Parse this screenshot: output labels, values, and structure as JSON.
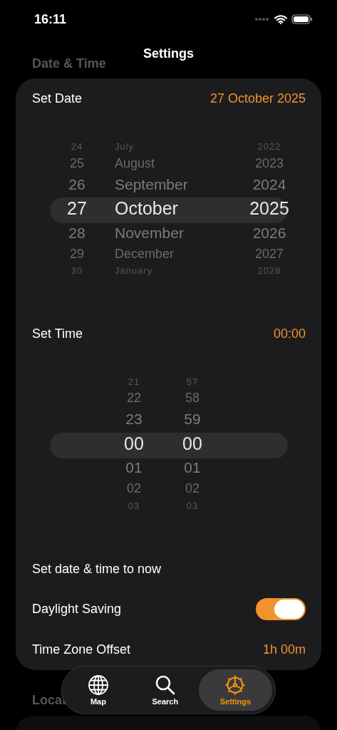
{
  "status_bar": {
    "time": "16:11"
  },
  "nav": {
    "title": "Settings"
  },
  "section_header": "Date & Time",
  "date_row": {
    "label": "Set Date",
    "value": "27 October 2025"
  },
  "date_picker": {
    "columns": [
      {
        "kind": "day",
        "items": [
          {
            "label": "24",
            "selected": false
          },
          {
            "label": "25",
            "selected": false
          },
          {
            "label": "26",
            "selected": false
          },
          {
            "label": "27",
            "selected": true
          },
          {
            "label": "28",
            "selected": false
          },
          {
            "label": "29",
            "selected": false
          },
          {
            "label": "30",
            "selected": false
          }
        ]
      },
      {
        "kind": "month",
        "items": [
          {
            "label": "July",
            "selected": false
          },
          {
            "label": "August",
            "selected": false
          },
          {
            "label": "September",
            "selected": false
          },
          {
            "label": "October",
            "selected": true
          },
          {
            "label": "November",
            "selected": false
          },
          {
            "label": "December",
            "selected": false
          },
          {
            "label": "January",
            "selected": false
          }
        ]
      },
      {
        "kind": "year",
        "items": [
          {
            "label": "2022",
            "selected": false
          },
          {
            "label": "2023",
            "selected": false
          },
          {
            "label": "2024",
            "selected": false
          },
          {
            "label": "2025",
            "selected": true
          },
          {
            "label": "2026",
            "selected": false
          },
          {
            "label": "2027",
            "selected": false
          },
          {
            "label": "2028",
            "selected": false
          }
        ]
      }
    ]
  },
  "time_row": {
    "label": "Set Time",
    "value": "00:00"
  },
  "time_picker": {
    "columns": [
      {
        "kind": "hour",
        "items": [
          {
            "label": "21",
            "selected": false
          },
          {
            "label": "22",
            "selected": false
          },
          {
            "label": "23",
            "selected": false
          },
          {
            "label": "00",
            "selected": true
          },
          {
            "label": "01",
            "selected": false
          },
          {
            "label": "02",
            "selected": false
          },
          {
            "label": "03",
            "selected": false
          }
        ]
      },
      {
        "kind": "minute",
        "items": [
          {
            "label": "57",
            "selected": false
          },
          {
            "label": "58",
            "selected": false
          },
          {
            "label": "59",
            "selected": false
          },
          {
            "label": "00",
            "selected": true
          },
          {
            "label": "01",
            "selected": false
          },
          {
            "label": "02",
            "selected": false
          },
          {
            "label": "03",
            "selected": false
          }
        ]
      }
    ]
  },
  "now_button": "Set date & time to now",
  "daylight_saving": {
    "label": "Daylight Saving",
    "on": true
  },
  "timezone_row": {
    "label": "Time Zone Offset",
    "value": "1h 00m"
  },
  "next_section_header": "Locat",
  "tab_bar": [
    {
      "kind": "map",
      "label": "Map",
      "selected": false
    },
    {
      "kind": "search",
      "label": "Search",
      "selected": false
    },
    {
      "kind": "settings",
      "label": "Settings",
      "selected": true
    }
  ]
}
